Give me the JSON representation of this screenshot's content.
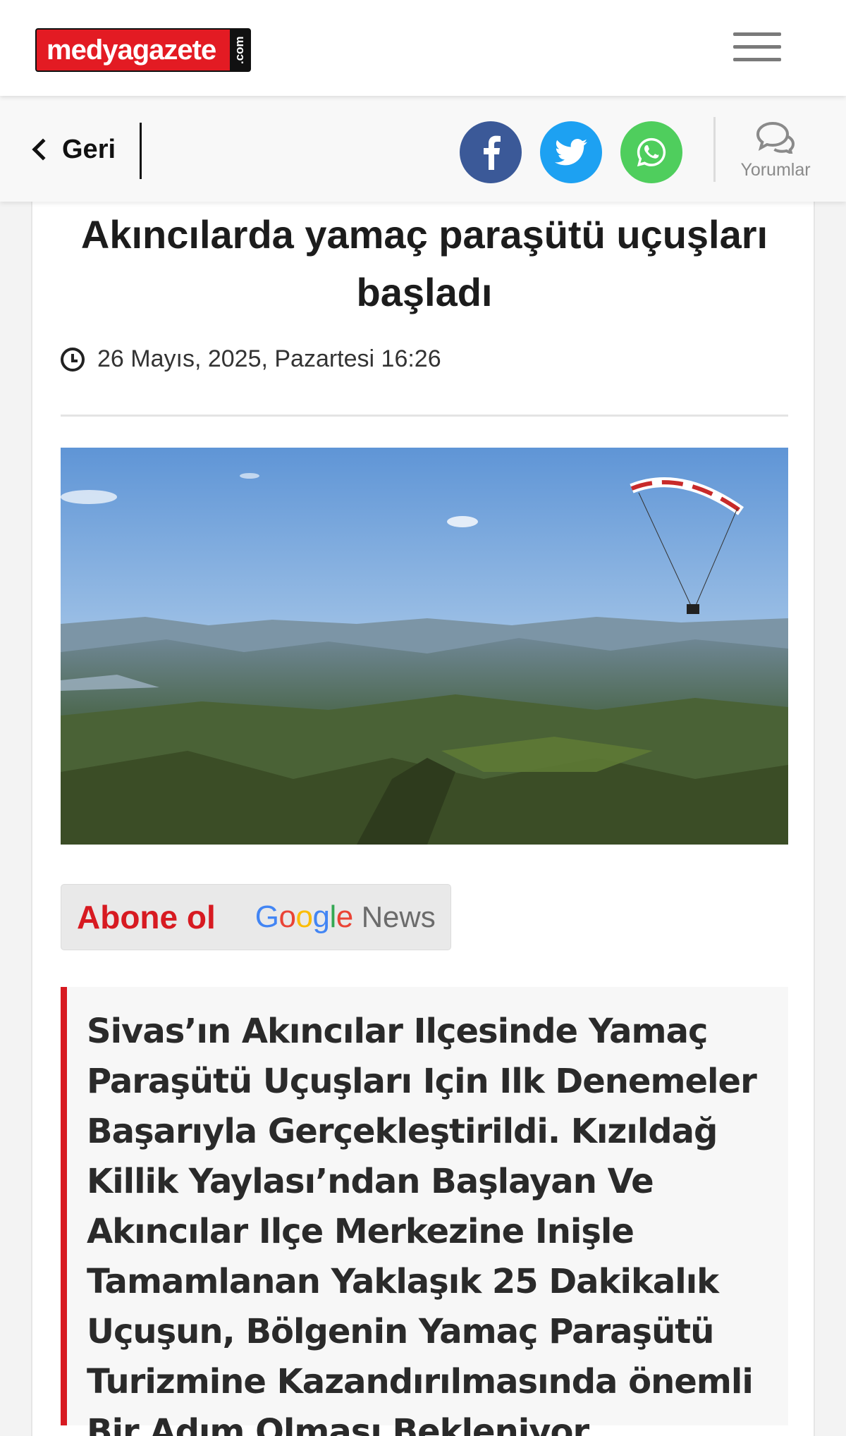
{
  "header": {
    "logo_text": "medyagazete",
    "logo_suffix": ".com",
    "menu_icon": "hamburger-menu-icon"
  },
  "sharebar": {
    "back_label": "Geri",
    "share": [
      {
        "name": "facebook",
        "icon": "facebook-icon",
        "color": "#3b5998"
      },
      {
        "name": "twitter",
        "icon": "twitter-icon",
        "color": "#1da1f2"
      },
      {
        "name": "whatsapp",
        "icon": "whatsapp-icon",
        "color": "#4fce5d"
      }
    ],
    "comments_label": "Yorumlar"
  },
  "article": {
    "title": "Akıncılarda yamaç paraşütü uçuşları başladı",
    "date": "26 Mayıs, 2025, Pazartesi 16:26",
    "image_alt": "",
    "subscribe": {
      "abone": "Abone ol",
      "google_letters": [
        "G",
        "o",
        "o",
        "g",
        "l",
        "e"
      ],
      "google_colors": [
        "#4285f4",
        "#ea4335",
        "#fbbc05",
        "#4285f4",
        "#34a853",
        "#ea4335"
      ],
      "news": "News"
    },
    "summary": "Sivas’ın Akıncılar Ilçesinde Yamaç Paraşütü Uçuşları Için Ilk Denemeler Başarıyla Gerçekleştirildi. Kızıldağ Killik Yaylası’ndan Başlayan Ve Akıncılar Ilçe Merkezine Inişle Tamamlanan Yaklaşık 25 Dakikalık Uçuşun, Bölgenin Yamaç Paraşütü Turizmine Kazandırılmasında önemli Bir Adım Olması Bekleniyor."
  },
  "colors": {
    "brand_red": "#e31b23",
    "accent_red": "#d71a21"
  }
}
